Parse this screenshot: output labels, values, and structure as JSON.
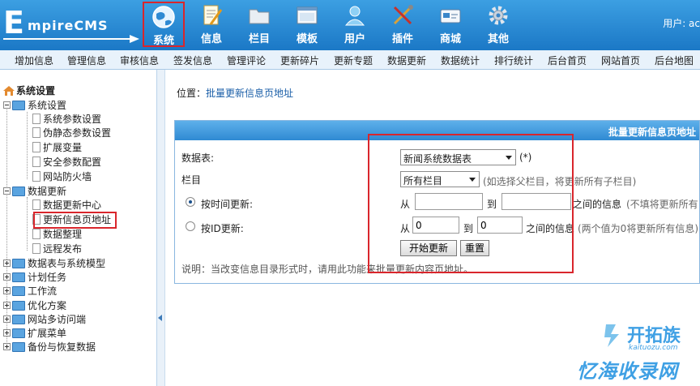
{
  "header": {
    "logo": {
      "e": "E",
      "rest": "mpireCMS"
    },
    "nav": [
      {
        "label": "系统",
        "icon": "globe-icon",
        "active": true
      },
      {
        "label": "信息",
        "icon": "document-edit-icon"
      },
      {
        "label": "栏目",
        "icon": "folder-icon"
      },
      {
        "label": "模板",
        "icon": "template-window-icon"
      },
      {
        "label": "用户",
        "icon": "user-icon"
      },
      {
        "label": "插件",
        "icon": "tools-icon"
      },
      {
        "label": "商城",
        "icon": "shop-card-icon"
      },
      {
        "label": "其他",
        "icon": "gear-icon"
      }
    ],
    "user_text": "用户: ac"
  },
  "submenu": [
    "增加信息",
    "管理信息",
    "审核信息",
    "签发信息",
    "管理评论",
    "更新碎片",
    "更新专题",
    "数据更新",
    "数据统计",
    "排行统计",
    "后台首页",
    "网站首页",
    "后台地图"
  ],
  "sidebar": {
    "root": "系统设置",
    "groups": [
      {
        "label": "系统设置",
        "expanded": true,
        "children": [
          "系统参数设置",
          "伪静态参数设置",
          "扩展变量",
          "安全参数配置",
          "网站防火墙"
        ]
      },
      {
        "label": "数据更新",
        "expanded": true,
        "children": [
          "数据更新中心",
          "更新信息页地址",
          "数据整理",
          "远程发布"
        ]
      },
      {
        "label": "数据表与系统模型",
        "expanded": false
      },
      {
        "label": "计划任务",
        "expanded": false
      },
      {
        "label": "工作流",
        "expanded": false
      },
      {
        "label": "优化方案",
        "expanded": false
      },
      {
        "label": "网站多访问端",
        "expanded": false
      },
      {
        "label": "扩展菜单",
        "expanded": false
      },
      {
        "label": "备份与恢复数据",
        "expanded": false
      }
    ],
    "selected": "更新信息页地址"
  },
  "main": {
    "breadcrumb_prefix": "位置：",
    "breadcrumb_link": "批量更新信息页地址",
    "panel_title": "批量更新信息页地址",
    "table_label": "数据表:",
    "table_value": "新闻系统数据表",
    "required_mark": "(*)",
    "column_label": "栏目",
    "column_value": "所有栏目",
    "column_hint": "(如选择父栏目，将更新所有子栏目)",
    "time_label": "按时间更新:",
    "time_from": "从",
    "time_to": "到",
    "time_between": "之间的信息",
    "time_hint": "(不填将更新所有",
    "id_label": "按ID更新:",
    "id_from": "从",
    "id_start": "0",
    "id_to": "到",
    "id_end": "0",
    "id_between": "之间的信息",
    "id_hint": "(两个值为0将更新所有信息)",
    "btn_start": "开始更新",
    "btn_reset": "重置",
    "note": "说明：当改变信息目录形式时，请用此功能来批量更新内容页地址。"
  },
  "watermark": {
    "brand": "开拓族",
    "url": "kaituozu.com",
    "slogan": "忆海收录网"
  },
  "colors": {
    "header": "#1b78c6",
    "highlight": "#d9262c",
    "link": "#1b5fa8"
  }
}
